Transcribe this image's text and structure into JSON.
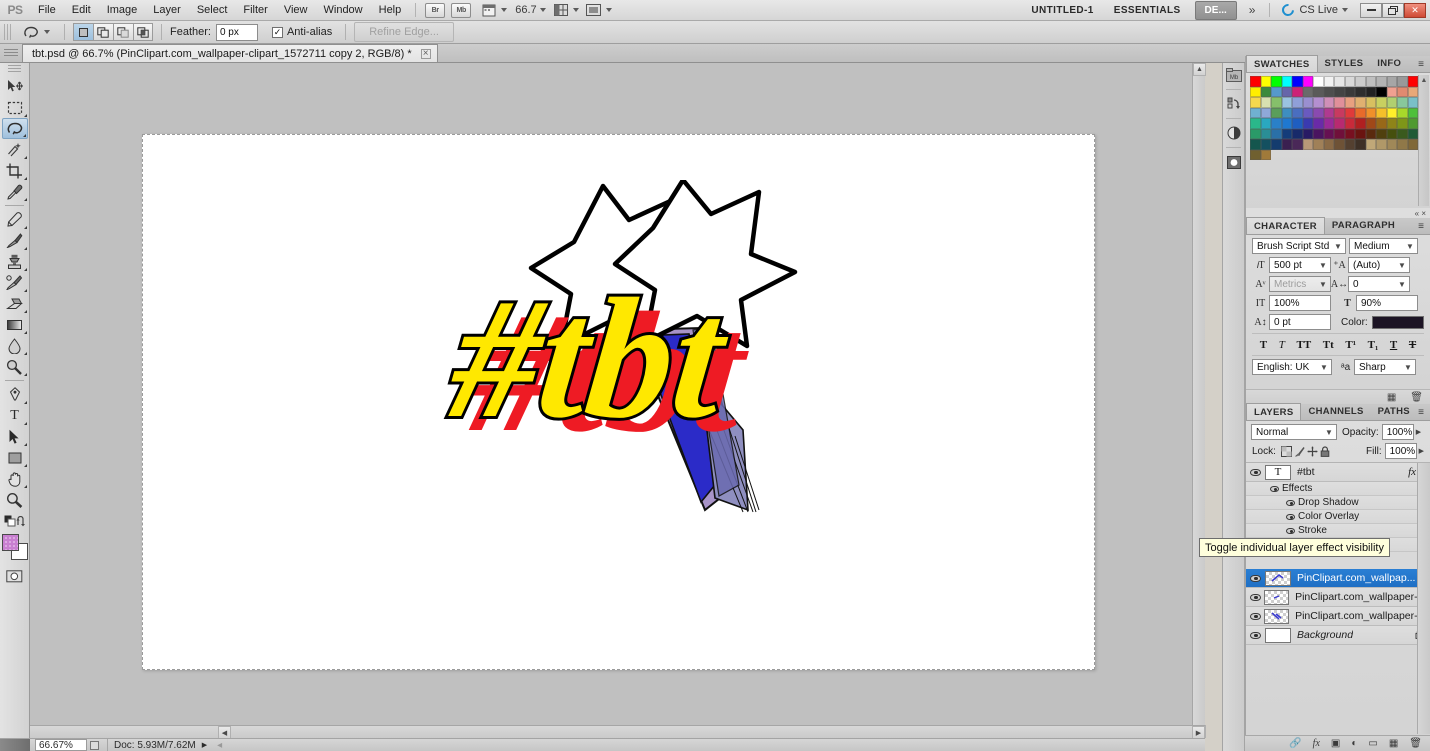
{
  "app": {
    "logo": "PS",
    "menus": [
      "File",
      "Edit",
      "Image",
      "Layer",
      "Select",
      "Filter",
      "View",
      "Window",
      "Help"
    ],
    "bridge_label": "Br",
    "minibridge_label": "Mb",
    "zoom_level": "66.7",
    "workspace_doc": "UNTITLED-1",
    "workspace_name": "ESSENTIALS",
    "workspace_extra": "DE...",
    "chevron": "»",
    "cs_live": "CS Live",
    "win_minimize": "—",
    "win_restore": "❐",
    "win_close": "✕"
  },
  "options_bar": {
    "tool_icon": "lasso-tool-icon",
    "feather_label": "Feather:",
    "feather_value": "0 px",
    "antialias_label": "Anti-alias",
    "antialias_checked": "✓",
    "refine_edge_label": "Refine Edge...",
    "selection_modes": [
      "new-selection",
      "add-to-selection",
      "subtract-from-selection",
      "intersect-selection"
    ]
  },
  "document": {
    "tab_title": "tbt.psd @ 66.7% (PinClipart.com_wallpaper-clipart_1572711 copy 2, RGB/8) *",
    "close_glyph": "×"
  },
  "toolbox": {
    "tools": [
      {
        "name": "move-tool",
        "glyph": "✥",
        "selected": false,
        "sub": false
      },
      {
        "name": "rectangular-marquee-tool",
        "glyph": "⬚",
        "selected": false,
        "sub": true
      },
      {
        "name": "lasso-tool",
        "glyph": "◯",
        "selected": true,
        "sub": true
      },
      {
        "name": "quick-selection-tool",
        "glyph": "✎",
        "selected": false,
        "sub": true
      },
      {
        "name": "crop-tool",
        "glyph": "⌧",
        "selected": false,
        "sub": true
      },
      {
        "name": "eyedropper-tool",
        "glyph": "✒",
        "selected": false,
        "sub": true
      },
      {
        "name": "spot-healing-brush-tool",
        "glyph": "✐",
        "selected": false,
        "sub": true
      },
      {
        "name": "brush-tool",
        "glyph": "✒",
        "selected": false,
        "sub": true
      },
      {
        "name": "clone-stamp-tool",
        "glyph": "⚑",
        "selected": false,
        "sub": true
      },
      {
        "name": "history-brush-tool",
        "glyph": "✐",
        "selected": false,
        "sub": true
      },
      {
        "name": "eraser-tool",
        "glyph": "▰",
        "selected": false,
        "sub": true
      },
      {
        "name": "gradient-tool",
        "glyph": "◧",
        "selected": false,
        "sub": true
      },
      {
        "name": "blur-tool",
        "glyph": "◌",
        "selected": false,
        "sub": true
      },
      {
        "name": "dodge-tool",
        "glyph": "⚲",
        "selected": false,
        "sub": true
      },
      {
        "name": "pen-tool",
        "glyph": "✒",
        "selected": false,
        "sub": true
      },
      {
        "name": "horizontal-type-tool",
        "glyph": "T",
        "selected": false,
        "sub": true
      },
      {
        "name": "path-selection-tool",
        "glyph": "➤",
        "selected": false,
        "sub": true
      },
      {
        "name": "rectangle-tool",
        "glyph": "■",
        "selected": false,
        "sub": true
      },
      {
        "name": "hand-tool",
        "glyph": "✋",
        "selected": false,
        "sub": true
      },
      {
        "name": "zoom-tool",
        "glyph": "⚲",
        "selected": false,
        "sub": false
      }
    ],
    "foreground_color": "#c87fd0",
    "background_color": "#ffffff",
    "quick_mask_label": "quick-mask-mode",
    "screen_mode_label": "screen-mode"
  },
  "status_bar": {
    "zoom": "66.67%",
    "doc_info": "Doc: 5.93M/7.62M"
  },
  "dock_icons": [
    {
      "name": "mini-bridge-icon",
      "label": "Mb"
    },
    {
      "name": "history-icon",
      "label": "↺"
    },
    {
      "name": "adjustments-icon",
      "label": "◐"
    },
    {
      "name": "masks-icon",
      "label": "▣"
    }
  ],
  "swatches_panel": {
    "tabs": [
      "SWATCHES",
      "STYLES",
      "INFO"
    ],
    "active_tab": "SWATCHES",
    "menu_glyph": "≡",
    "colors": [
      "#ff0000",
      "#ffff00",
      "#00ff00",
      "#00ffff",
      "#0000ff",
      "#ff00ff",
      "#ffffff",
      "#f2f2f2",
      "#e6e6e6",
      "#d9d9d9",
      "#cccccc",
      "#bfbfbf",
      "#b3b3b3",
      "#a6a6a6",
      "#999999",
      "#ff0000",
      "#ffee00",
      "#3c8a3c",
      "#5599cc",
      "#6666aa",
      "#cc2277",
      "#6a6a6a",
      "#5a5a5a",
      "#4e4e4e",
      "#444444",
      "#3a3a3a",
      "#2e2e2e",
      "#222222",
      "#000000",
      "#f0a090",
      "#e08a70",
      "#e8a878",
      "#f5d84e",
      "#d8e0b0",
      "#86c06a",
      "#9ac3e0",
      "#8f9fd8",
      "#9a8fd0",
      "#b48fd0",
      "#d08fb8",
      "#e08f9a",
      "#e8a080",
      "#e0b070",
      "#d8c060",
      "#c8d060",
      "#b0d070",
      "#88c89a",
      "#7ac0c8",
      "#70b0d0",
      "#8fa8d8",
      "#5a9e5a",
      "#3e8ec0",
      "#4a6ec0",
      "#6a5ac0",
      "#8a4ab0",
      "#b03a90",
      "#c83a60",
      "#e03a3a",
      "#e86a2a",
      "#f0902a",
      "#f5c02a",
      "#fff02a",
      "#a8d82a",
      "#4ec03a",
      "#2ab88a",
      "#2aa8c0",
      "#2a80c8",
      "#1f78d0",
      "#1f5ec0",
      "#3a3ab0",
      "#6a2aa8",
      "#9a2a98",
      "#b82a70",
      "#c82a3a",
      "#b02020",
      "#a04818",
      "#986818",
      "#8e8418",
      "#7e9618",
      "#509a30",
      "#2a9a68",
      "#2a8e96",
      "#2a70a8",
      "#143c7a",
      "#182a6a",
      "#281a64",
      "#4a1460",
      "#661052",
      "#70103a",
      "#781020",
      "#6a1410",
      "#5a2a0e",
      "#50400e",
      "#46500e",
      "#3a5a1e",
      "#1f5a36",
      "#14564e",
      "#145060",
      "#143c6e",
      "#3a2050",
      "#4a2858",
      "#b89878",
      "#a08058",
      "#8a6a46",
      "#6e5236",
      "#544030",
      "#3e3026",
      "#c0a878",
      "#b09868",
      "#a08858",
      "#907848",
      "#806838",
      "#706030",
      "#a07a3a",
      ""
    ]
  },
  "character_panel": {
    "tabs": [
      "CHARACTER",
      "PARAGRAPH"
    ],
    "active_tab": "CHARACTER",
    "menu_glyph": "≡",
    "font_family": "Brush Script Std",
    "font_style": "Medium",
    "font_size": "500 pt",
    "leading": "(Auto)",
    "kerning": "Metrics",
    "tracking": "0",
    "vertical_scale": "100%",
    "horizontal_scale": "90%",
    "baseline_shift": "0 pt",
    "color_label": "Color:",
    "color_value": "#1c1424",
    "style_buttons": [
      "T",
      "T",
      "TT",
      "Tt",
      "T¹",
      "T₁",
      "T",
      "T"
    ],
    "language": "English: UK",
    "antialias_method": "Sharp"
  },
  "layers_panel": {
    "tabs": [
      "LAYERS",
      "CHANNELS",
      "PATHS"
    ],
    "active_tab": "LAYERS",
    "menu_glyph": "≡",
    "blend_mode": "Normal",
    "opacity_label": "Opacity:",
    "opacity_value": "100%",
    "lock_label": "Lock:",
    "fill_label": "Fill:",
    "fill_value": "100%",
    "lock_icons": [
      "lock-transparent-pixels",
      "lock-image-pixels",
      "lock-position",
      "lock-all"
    ],
    "layers": [
      {
        "name": "#tbt",
        "type": "text",
        "thumb": "T",
        "fx": "fx",
        "selected": false,
        "italic": false
      },
      {
        "name": "PinClipart.com_wallpap...",
        "type": "pixel",
        "thumb": "",
        "fx": "",
        "selected": true,
        "italic": false
      },
      {
        "name": "PinClipart.com_wallpaper-cli...",
        "type": "pixel",
        "thumb": "",
        "fx": "",
        "selected": false,
        "italic": false
      },
      {
        "name": "PinClipart.com_wallpaper-cli...",
        "type": "pixel",
        "thumb": "",
        "fx": "",
        "selected": false,
        "italic": false
      },
      {
        "name": "Background",
        "type": "background",
        "thumb": "",
        "fx": "",
        "selected": false,
        "italic": true
      }
    ],
    "effects_group_label": "Effects",
    "effects": [
      "Drop Shadow",
      "Color Overlay",
      "Stroke"
    ],
    "footer_icons": [
      "link-layers-icon",
      "add-layer-style-icon",
      "add-layer-mask-icon",
      "new-adjustment-layer-icon",
      "new-group-icon",
      "new-layer-icon",
      "delete-layer-icon"
    ]
  },
  "tooltip": {
    "text": "Toggle individual layer effect visibility"
  },
  "artwork": {
    "text": "#tbt",
    "text_fill": "#ffe800",
    "text_stroke": "#000000",
    "shadow_color": "#ee1b24",
    "star_fill": "#ffffff",
    "star_stroke": "#000000",
    "comet_colors": [
      "#2b2bc8",
      "#a894c8",
      "#6a6ab0"
    ]
  }
}
